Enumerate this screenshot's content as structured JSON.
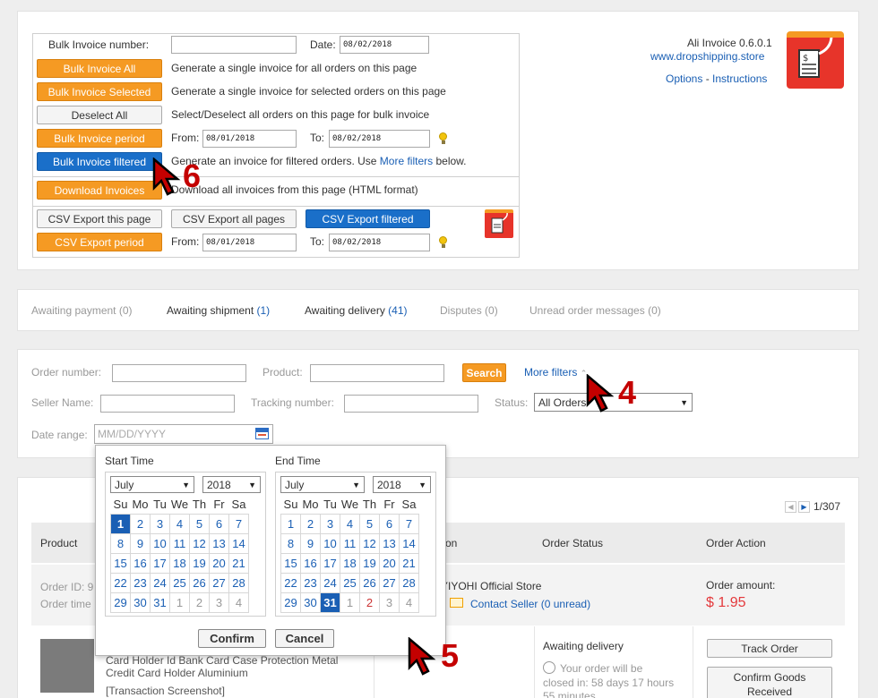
{
  "bulk": {
    "number_label": "Bulk Invoice number:",
    "number_value": "",
    "date_label": "Date:",
    "date_value": "08/02/2018",
    "rows": [
      {
        "button": "Bulk Invoice All",
        "desc": "Generate a single invoice for all orders on this page"
      },
      {
        "button": "Bulk Invoice Selected",
        "desc": "Generate a single invoice for selected orders on this page"
      },
      {
        "button": "Deselect All",
        "desc": "Select/Deselect all orders on this page for bulk invoice"
      }
    ],
    "period_button": "Bulk Invoice period",
    "from_label": "From:",
    "from_value": "08/01/2018",
    "to_label": "To:",
    "to_value": "08/02/2018",
    "filtered_button": "Bulk Invoice filtered",
    "filtered_desc_pre": "Generate an invoice for filtered orders. Use",
    "filtered_desc_link": "More filters",
    "filtered_desc_post": "below.",
    "download_button": "Download Invoices",
    "download_desc": "Download all invoices from this page (HTML format)",
    "csv_page": "CSV Export this page",
    "csv_all": "CSV Export all pages",
    "csv_filtered": "CSV Export filtered",
    "csv_period": "CSV Export period",
    "csv_from_value": "08/01/2018",
    "csv_to_value": "08/02/2018"
  },
  "brand": {
    "name": "Ali Invoice 0.6.0.1",
    "site": "www.dropshipping.store",
    "options": "Options",
    "sep": "-",
    "instructions": "Instructions"
  },
  "tabs": [
    {
      "label": "Awaiting payment",
      "count": "(0)"
    },
    {
      "label": "Awaiting shipment",
      "count": "(1)"
    },
    {
      "label": "Awaiting delivery",
      "count": "(41)"
    },
    {
      "label": "Disputes",
      "count": "(0)"
    },
    {
      "label": "Unread order messages",
      "count": "(0)"
    }
  ],
  "filters": {
    "order_number": "Order number:",
    "product": "Product:",
    "search": "Search",
    "more_filters": "More filters",
    "seller_name": "Seller Name:",
    "tracking_number": "Tracking number:",
    "status_label": "Status:",
    "status_value": "All Orders",
    "date_range": "Date range:",
    "date_placeholder": "MM/DD/YYYY"
  },
  "calendar": {
    "start_title": "Start Time",
    "end_title": "End Time",
    "month": "July",
    "year": "2018",
    "days": [
      "Su",
      "Mo",
      "Tu",
      "We",
      "Th",
      "Fr",
      "Sa"
    ],
    "confirm": "Confirm",
    "cancel": "Cancel"
  },
  "orders": {
    "pagination": "1/307",
    "headers": {
      "product": "Product",
      "order_status": "Order Status",
      "order_action": "Order Action",
      "partial": "on"
    },
    "order_id_label": "Order ID: 9",
    "order_time_label": "Order time",
    "store": "YIYOHI Official Store",
    "contact": "Contact Seller",
    "unread": "(0 unread)",
    "amount_label": "Order amount:",
    "amount": "$ 1.95",
    "product_line1": "Card Holder Id Bank Card Case Protection Metal",
    "product_line2": "Credit Card Holder Aluminium",
    "product_line3": "[Transaction Screenshot]",
    "status": "Awaiting delivery",
    "status_detail1": "Your order will be",
    "status_detail2": "closed in: 58 days 17 hours",
    "status_detail3": "55 minutes",
    "track_button": "Track Order",
    "confirm_button1": "Confirm Goods",
    "confirm_button2": "Received"
  },
  "annotations": {
    "n6": "6",
    "n4": "4",
    "n5": "5"
  },
  "colors": {
    "orange": "#f59a23",
    "blue": "#1a6fc9",
    "link": "#1a5fb4",
    "price": "#e4393c"
  }
}
